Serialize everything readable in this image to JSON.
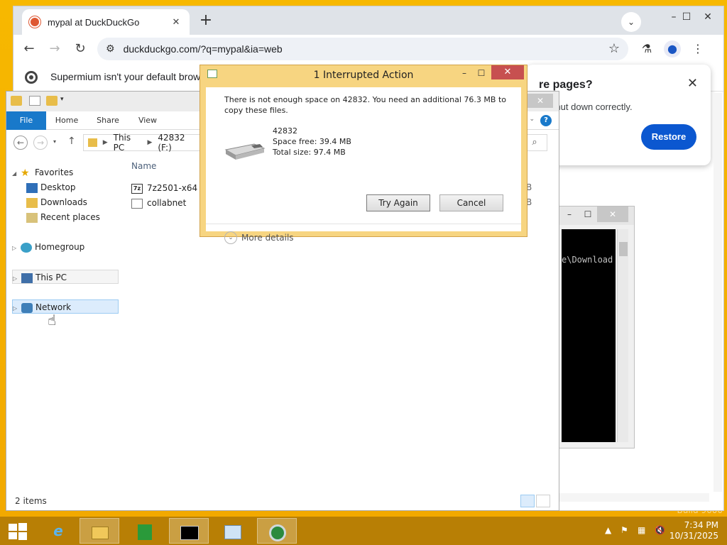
{
  "browser": {
    "tab_title": "mypal at DuckDuckGo",
    "tab_close": "✕",
    "new_tab": "+",
    "url": "duckduckgo.com/?q=mypal&ia=web",
    "infobar_text": "Supermium isn't your default browse",
    "restore_title": "re pages?",
    "restore_body": "n't shut down correctly.",
    "restore_button": "Restore",
    "restore_close": "✕"
  },
  "cmd": {
    "text": "e\\Download"
  },
  "explorer": {
    "ribbon_tabs": [
      "File",
      "Home",
      "Share",
      "View"
    ],
    "help": "?",
    "breadcrumb": [
      "This PC",
      "42832 (F:)"
    ],
    "nav": {
      "favorites": "Favorites",
      "desktop": "Desktop",
      "downloads": "Downloads",
      "recent": "Recent places",
      "homegroup": "Homegroup",
      "this_pc": "This PC",
      "network": "Network"
    },
    "column_name": "Name",
    "files": [
      {
        "name": "7z2501-x64",
        "size_peek": "B"
      },
      {
        "name": "collabnet",
        "size_peek": "B"
      }
    ],
    "item_count": "2 items"
  },
  "dialog": {
    "title": "1 Interrupted Action",
    "message": "There is not enough space on 42832. You need an additional 76.3 MB to copy these files.",
    "drive_name": "42832",
    "space_free": "Space free: 39.4 MB",
    "total_size": "Total size: 97.4 MB",
    "try_again": "Try Again",
    "cancel": "Cancel",
    "more_details": "More details",
    "minimize": "–",
    "maximize": "☐",
    "close": "✕"
  },
  "taskbar": {
    "time": "7:34 PM",
    "date": "10/31/2025"
  },
  "desktop": {
    "watermark": "Build 9600"
  },
  "colors": {
    "accent_blue": "#0b57d0",
    "file_tab": "#1979ca",
    "dialog_frame": "#f7d581",
    "taskbar": "#b87f05"
  }
}
